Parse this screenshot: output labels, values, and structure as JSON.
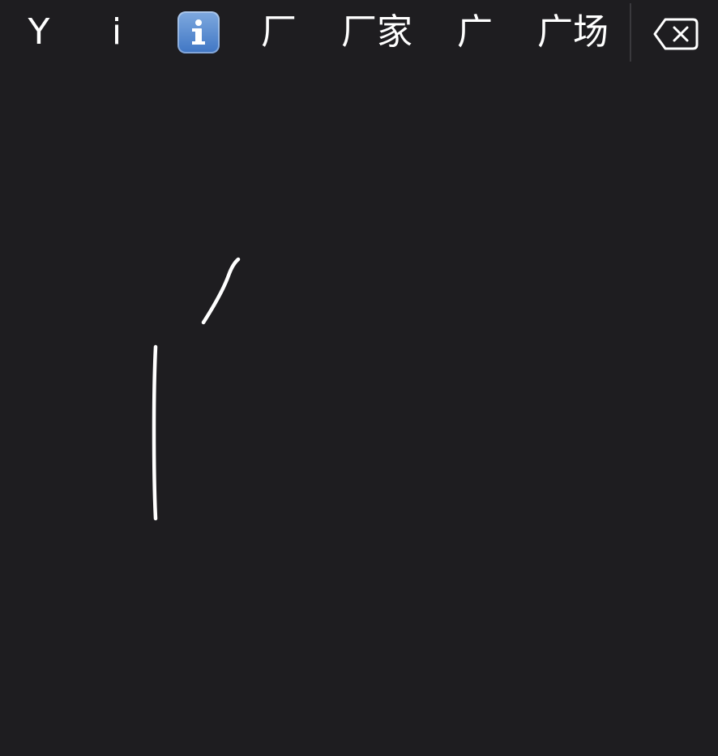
{
  "candidates": [
    "Y",
    "i",
    "",
    "厂",
    "厂家",
    "广",
    "广场"
  ],
  "icons": {
    "info_emoji": "information-emoji-icon",
    "delete": "backspace-delete-icon"
  },
  "colors": {
    "background": "#1e1d20",
    "text": "#ffffff",
    "stroke": "#ffffff",
    "divider": "#3a393d",
    "info_emoji_blue": "#4f86cf"
  }
}
